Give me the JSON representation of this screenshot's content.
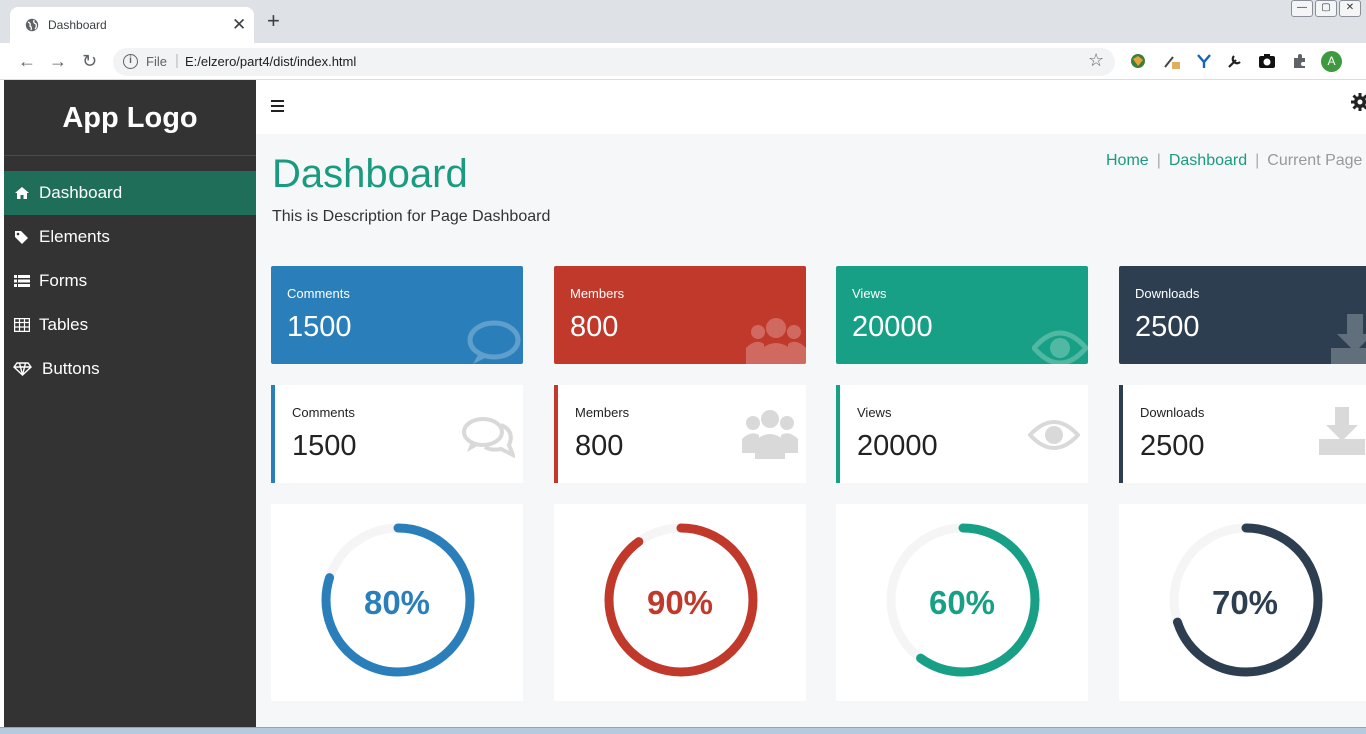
{
  "browser": {
    "tab_title": "Dashboard",
    "close_glyph": "✕",
    "newtab_glyph": "+",
    "file_label": "File",
    "separator": "|",
    "url": "E:/elzero/part4/dist/index.html",
    "profile_initial": "A",
    "win_buttons": [
      "—",
      "▢",
      "✕"
    ]
  },
  "sidebar": {
    "logo": "App Logo",
    "items": [
      {
        "label": "Dashboard",
        "icon": "home-icon",
        "active": true
      },
      {
        "label": "Elements",
        "icon": "tag-icon",
        "active": false
      },
      {
        "label": "Forms",
        "icon": "list-icon",
        "active": false
      },
      {
        "label": "Tables",
        "icon": "table-icon",
        "active": false
      },
      {
        "label": "Buttons",
        "icon": "diamond-icon",
        "active": false
      }
    ]
  },
  "page": {
    "title": "Dashboard",
    "description": "This is Description for Page Dashboard",
    "breadcrumb": {
      "home": "Home",
      "dashboard": "Dashboard",
      "current": "Current Page",
      "sep": "|"
    }
  },
  "stats_filled": [
    {
      "label": "Comments",
      "value": "1500",
      "color": "#2a7fbb",
      "icon": "comments-icon"
    },
    {
      "label": "Members",
      "value": "800",
      "color": "#c0392b",
      "icon": "users-icon"
    },
    {
      "label": "Views",
      "value": "20000",
      "color": "#17a085",
      "icon": "eye-icon"
    },
    {
      "label": "Downloads",
      "value": "2500",
      "color": "#2c3e50",
      "icon": "download-icon"
    }
  ],
  "stats_outline": [
    {
      "label": "Comments",
      "value": "1500",
      "color": "#2a7fbb",
      "icon": "comments-icon"
    },
    {
      "label": "Members",
      "value": "800",
      "color": "#c0392b",
      "icon": "users-icon"
    },
    {
      "label": "Views",
      "value": "20000",
      "color": "#17a085",
      "icon": "eye-icon"
    },
    {
      "label": "Downloads",
      "value": "2500",
      "color": "#2c3e50",
      "icon": "download-icon"
    }
  ],
  "progress": [
    {
      "label": "80%",
      "value": 0.8,
      "color": "#2a7fbb"
    },
    {
      "label": "90%",
      "value": 0.9,
      "color": "#c0392b"
    },
    {
      "label": "60%",
      "value": 0.6,
      "color": "#17a085"
    },
    {
      "label": "70%",
      "value": 0.7,
      "color": "#2c3e50"
    }
  ]
}
